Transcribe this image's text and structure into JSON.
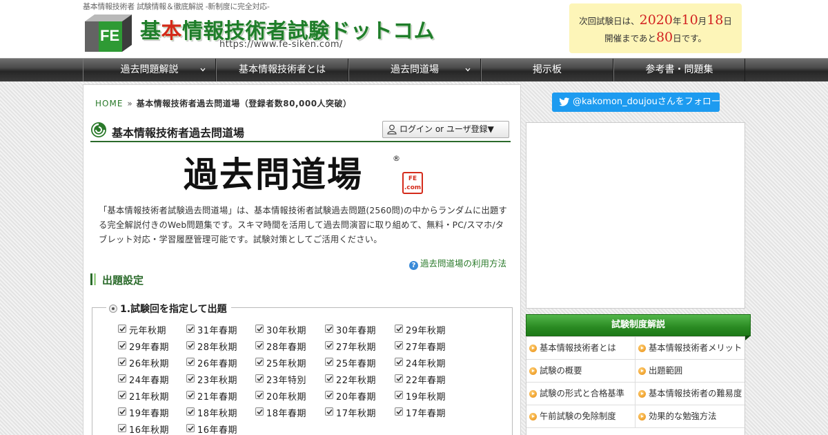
{
  "header": {
    "tagline": "基本情報技術者 試験情報＆徹底解説 -新制度に完全対応-",
    "logo_letters": "FE",
    "site_name_part1": "基",
    "site_name_accent": "本",
    "site_name_part2": "情報技術者試験ドットコム",
    "site_url": "https://www.fe-siken.com/",
    "exam": {
      "prefix": "次回試験日は、",
      "year": "2020",
      "year_unit": "年",
      "month": "10",
      "month_unit": "月",
      "day": "18",
      "day_unit": "日",
      "countdown_prefix": "開催まであと",
      "countdown_days": "80",
      "countdown_suffix": "日です。"
    }
  },
  "nav": {
    "items": [
      {
        "label": "過去問題解説",
        "has_dropdown": true
      },
      {
        "label": "基本情報技術者とは",
        "has_dropdown": false
      },
      {
        "label": "過去問道場",
        "has_dropdown": true
      },
      {
        "label": "掲示板",
        "has_dropdown": false
      },
      {
        "label": "参考書・問題集",
        "has_dropdown": false
      }
    ]
  },
  "breadcrumb": {
    "home": "HOME",
    "separator": "»",
    "current": "基本情報技術者過去問道場（登録者数80,000人突破）"
  },
  "main": {
    "page_title": "基本情報技術者過去問道場",
    "login_button": "ログイン or ユーザ登録▼",
    "brand_text": "過去問道場",
    "brand_reg": "®",
    "brand_badge_line1": "FE",
    "brand_badge_line2": ".com",
    "intro": "「基本情報技術者試験過去問道場」は、基本情報技術者試験過去問題(2560問)の中からランダムに出題する完全解説付きのWeb問題集です。スキマ時間を活用して過去問演習に取り組めて、無料・PC/スマホ/タブレット対応・学習履歴管理可能です。試験対策としてご活用ください。",
    "howto_link": "過去問道場の利用方法",
    "howto_icon_text": "?",
    "section_title": "出題設定",
    "fieldset_legend": "1.試験回を指定して出題",
    "exam_sessions": [
      {
        "label": "元年秋期",
        "checked": true
      },
      {
        "label": "31年春期",
        "checked": true
      },
      {
        "label": "30年秋期",
        "checked": true
      },
      {
        "label": "30年春期",
        "checked": true
      },
      {
        "label": "29年秋期",
        "checked": true
      },
      {
        "label": "29年春期",
        "checked": true
      },
      {
        "label": "28年秋期",
        "checked": true
      },
      {
        "label": "28年春期",
        "checked": true
      },
      {
        "label": "27年秋期",
        "checked": true
      },
      {
        "label": "27年春期",
        "checked": true
      },
      {
        "label": "26年秋期",
        "checked": true
      },
      {
        "label": "26年春期",
        "checked": true
      },
      {
        "label": "25年秋期",
        "checked": true
      },
      {
        "label": "25年春期",
        "checked": true
      },
      {
        "label": "24年秋期",
        "checked": true
      },
      {
        "label": "24年春期",
        "checked": true
      },
      {
        "label": "23年秋期",
        "checked": true
      },
      {
        "label": "23年特別",
        "checked": true
      },
      {
        "label": "22年秋期",
        "checked": true
      },
      {
        "label": "22年春期",
        "checked": true
      },
      {
        "label": "21年秋期",
        "checked": true
      },
      {
        "label": "21年春期",
        "checked": true
      },
      {
        "label": "20年秋期",
        "checked": true
      },
      {
        "label": "20年春期",
        "checked": true
      },
      {
        "label": "19年秋期",
        "checked": true
      },
      {
        "label": "19年春期",
        "checked": true
      },
      {
        "label": "18年秋期",
        "checked": true
      },
      {
        "label": "18年春期",
        "checked": true
      },
      {
        "label": "17年秋期",
        "checked": true
      },
      {
        "label": "17年春期",
        "checked": true
      },
      {
        "label": "16年秋期",
        "checked": true
      },
      {
        "label": "16年春期",
        "checked": true
      }
    ]
  },
  "sidebar": {
    "follow_button": "@kakomon_doujouさんをフォロー",
    "heading": "試験制度解説",
    "menu": [
      "基本情報技術者とは",
      "基本情報技術者メリット",
      "試験の概要",
      "出題範囲",
      "試験の形式と合格基準",
      "基本情報技術者の難易度",
      "午前試験の免除制度",
      "効果的な勉強方法"
    ]
  },
  "colors": {
    "brand_green": "#1f7d2a",
    "accent_red": "#d42a1a",
    "link_green": "#2a7a2a",
    "twitter_blue": "#1d9bf0",
    "exam_box_bg": "#fdf5b8",
    "sidebar_heading_green": "#2a8a22"
  },
  "icons": {
    "title_icon": "swirl-icon",
    "login_icon": "user-icon",
    "howto_icon": "question-icon",
    "follow_icon": "twitter-bird-icon",
    "menu_bullet": "orange-arrow-bullet-icon",
    "dropdown": "chevron-down-icon",
    "checkbox": "check-icon"
  }
}
